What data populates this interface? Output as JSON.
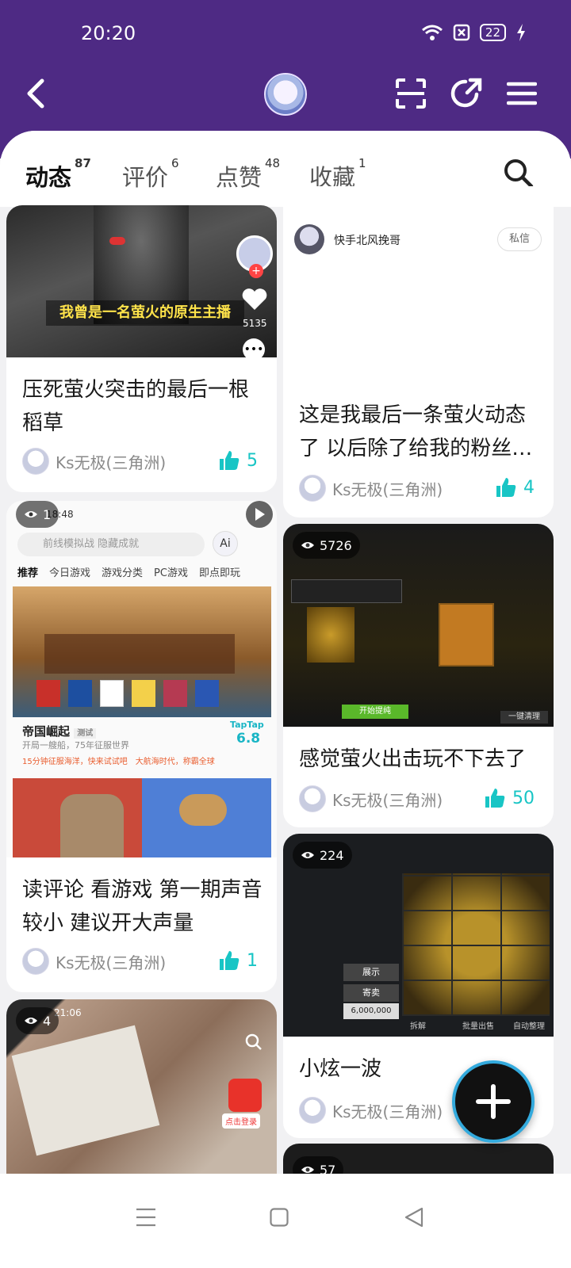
{
  "status_bar": {
    "time": "20:20",
    "battery": "22"
  },
  "tabs": [
    {
      "label": "动态",
      "count": "87"
    },
    {
      "label": "评价",
      "count": "6"
    },
    {
      "label": "点赞",
      "count": "48"
    },
    {
      "label": "收藏",
      "count": "1"
    }
  ],
  "left": [
    {
      "title": "压死萤火突击的最后一根稻草",
      "author": "Ks无极(三角洲)",
      "likes": "5",
      "overlay": "我曾是一名萤火的原生主播",
      "overlay_num": "5135"
    },
    {
      "title": "读评论 看游戏 第一期声音较小 建议开大声量",
      "author": "Ks无极(三角洲)",
      "likes": "1",
      "views": "1",
      "shot_time": "18:48",
      "shot_search": "前线模拟战 隐藏成就",
      "shot_tabs": [
        "推荐",
        "今日游戏",
        "游戏分类",
        "PC游戏",
        "即点即玩"
      ],
      "game_title": "帝国崛起",
      "game_tag": "测试",
      "game_desc": "开局一艘船，75年征服世界",
      "game_brand": "TapTap",
      "game_score": "6.8",
      "promo1": "15分钟征服海洋，快来试试吧",
      "promo2": "大航海时代，称霸全球"
    },
    {
      "views": "4",
      "shot_time": "21:06",
      "badge": "点击登录"
    }
  ],
  "right": [
    {
      "title": "这是我最后一条萤火动态了 以后除了给我的粉丝…",
      "author": "Ks无极(三角洲)",
      "likes": "4",
      "follower": "快手北风挽哥",
      "dm": "私信"
    },
    {
      "title": "感觉萤火出击玩不下去了",
      "author": "Ks无极(三角洲)",
      "likes": "50",
      "views": "5726",
      "btn1": "开始提纯",
      "btn2": "一键清理"
    },
    {
      "title": "小炫一波",
      "author": "Ks无极(三角洲)",
      "likes": "",
      "views": "224",
      "money": "6,000,000",
      "btn_show": "展示",
      "btn_sell": "寄卖",
      "btn_batch": "批量出售",
      "btn_auto": "自动整理",
      "btn_split": "拆解"
    },
    {
      "views": "57"
    }
  ],
  "colors": {
    "header": "#4e2a84",
    "accent": "#18c5c5"
  }
}
